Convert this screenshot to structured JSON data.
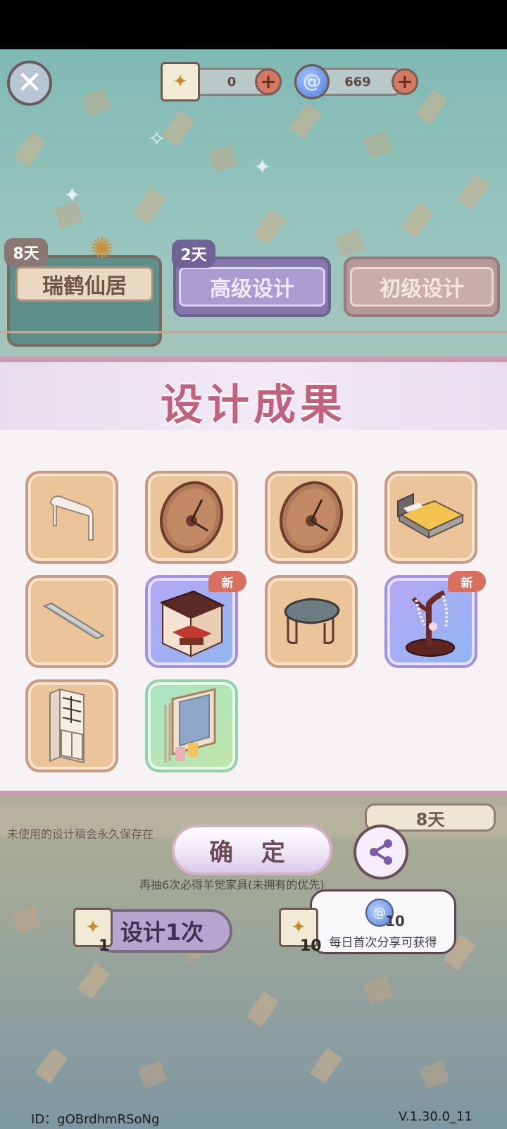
{
  "topbar": {
    "scroll_count": "0",
    "gem_count": "669"
  },
  "tabs": [
    {
      "label": "瑞鹤仙居",
      "days": "8天"
    },
    {
      "label": "高级设计",
      "days": "2天"
    },
    {
      "label": "初级设计",
      "days": ""
    }
  ],
  "modal": {
    "title": "设计成果",
    "items": [
      {
        "name": "long-bench",
        "icon": "bench-icon",
        "new": false
      },
      {
        "name": "wall-clock",
        "icon": "clock-icon",
        "new": false
      },
      {
        "name": "wall-clock",
        "icon": "clock-icon",
        "new": false
      },
      {
        "name": "bed",
        "icon": "bed-icon",
        "new": false
      },
      {
        "name": "floor-panel",
        "icon": "panel-icon",
        "new": false
      },
      {
        "name": "canopy-bed",
        "icon": "canopy-bed-icon",
        "new": true
      },
      {
        "name": "stool",
        "icon": "stool-icon",
        "new": false
      },
      {
        "name": "jewelry-tree",
        "icon": "jewelry-tree-icon",
        "new": true
      },
      {
        "name": "cabinet",
        "icon": "cabinet-icon",
        "new": false
      },
      {
        "name": "towel-rack-mirror",
        "icon": "mirror-icon",
        "new": false
      }
    ],
    "new_label": "新"
  },
  "bottom": {
    "notice": "未使用的设计稿会永久保存在",
    "right_days": "8天",
    "confirm_label": "确 定",
    "draw_hint": "再抽6次必得羊觉家具(未拥有的优先)",
    "design_once_label": "设计1次",
    "design_once_count": "1",
    "design_ten_count": "10",
    "tooltip_amount": "10",
    "tooltip_text": "每日首次分享可获得"
  },
  "footer": {
    "id_text": "ID：gOBrdhmRSoNg",
    "version": "V.1.30.0_11"
  }
}
